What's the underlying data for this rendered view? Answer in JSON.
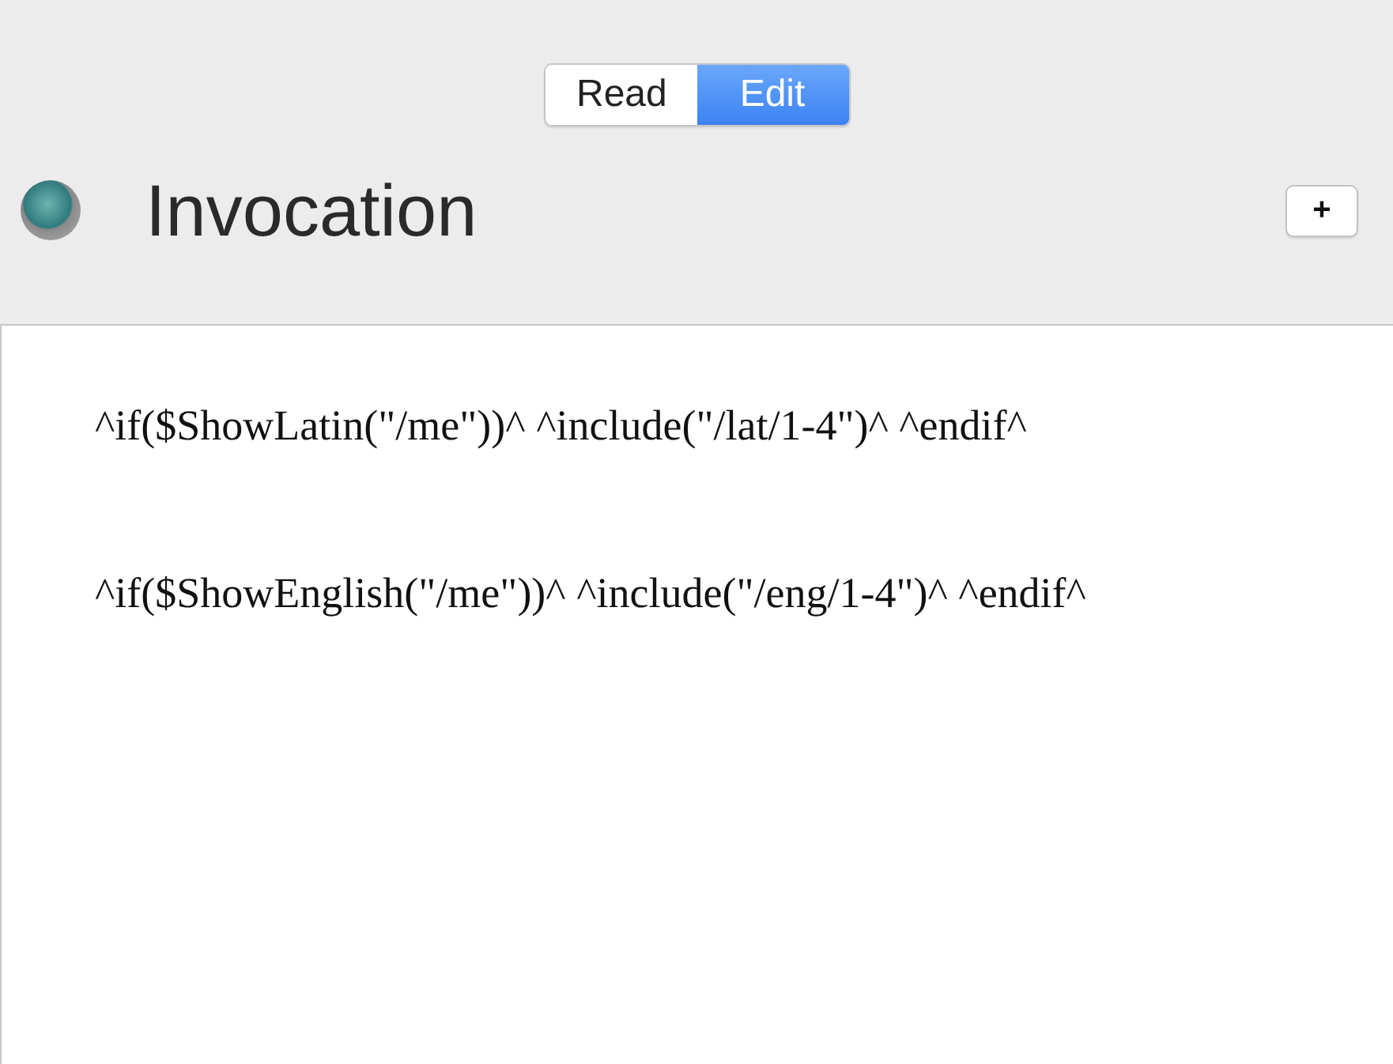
{
  "mode_tabs": [
    {
      "label": "Read",
      "selected": false
    },
    {
      "label": "Edit",
      "selected": true
    }
  ],
  "title": "Invocation",
  "add_button": "+",
  "editor_paragraphs": [
    "^if($ShowLatin(\"/me\"))^ ^include(\"/lat/1-4\")^ ^endif^",
    "^if($ShowEnglish(\"/me\"))^ ^include(\"/eng/1-4\")^ ^endif^"
  ]
}
